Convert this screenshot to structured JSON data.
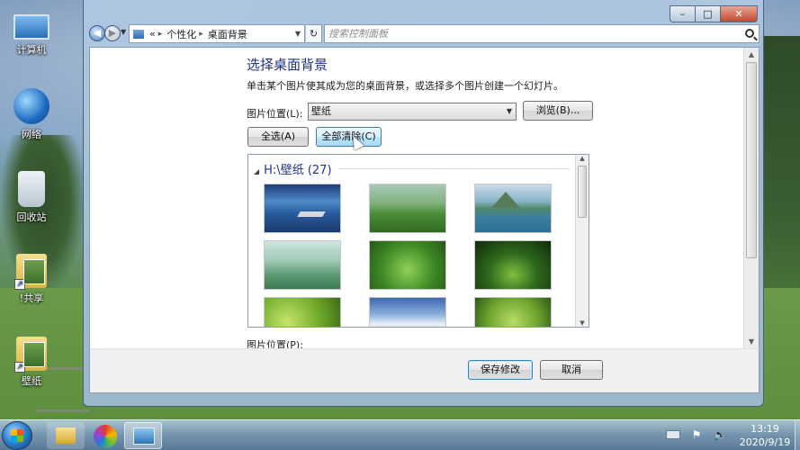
{
  "desktop": {
    "icons": [
      {
        "label": "计算机",
        "icon": "computer-icon"
      },
      {
        "label": "网络",
        "icon": "network-icon"
      },
      {
        "label": "回收站",
        "icon": "recycle-bin-icon"
      },
      {
        "label": "!共享",
        "icon": "shared-folder-icon"
      },
      {
        "label": "壁纸",
        "icon": "wallpaper-folder-icon"
      }
    ]
  },
  "window": {
    "caption_buttons": {
      "minimize": "–",
      "maximize": "□",
      "close": "✕"
    },
    "address": {
      "separator": "«",
      "crumb1": "个性化",
      "crumb_sep": "▸",
      "crumb2": "桌面背景"
    },
    "refresh_glyph": "↻",
    "search_placeholder": "搜索控制面板",
    "content": {
      "heading": "选择桌面背景",
      "description": "单击某个图片使其成为您的桌面背景，或选择多个图片创建一个幻灯片。",
      "location_label": "图片位置(L):",
      "location_value": "壁纸",
      "browse_button": "浏览(B)...",
      "select_all_button": "全选(A)",
      "clear_all_button": "全部清除(C)",
      "gallery": {
        "group_title": "H:\\壁纸 (27)",
        "thumbnails": 9
      },
      "position_label": "图片位置(P):"
    },
    "footer": {
      "save_button": "保存修改",
      "cancel_button": "取消"
    }
  },
  "taskbar": {
    "items": [
      "start-orb",
      "windows-explorer",
      "color-app",
      "control-panel"
    ],
    "clock_time": "13:19",
    "clock_date": "2020/9/19"
  }
}
